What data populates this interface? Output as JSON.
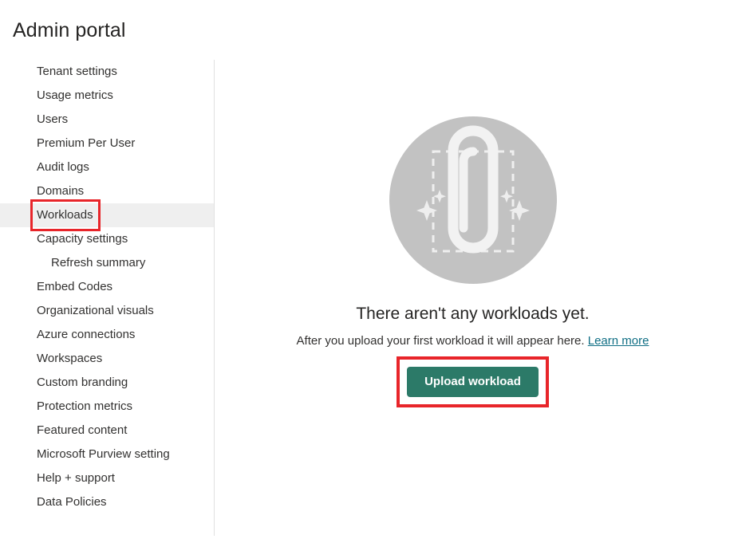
{
  "header": {
    "title": "Admin portal"
  },
  "colors": {
    "annotation_red": "#e8252a",
    "button_green": "#2c7a68",
    "link_teal": "#0f6e84",
    "selected_row": "#efefef",
    "illustration_circle": "#c2c2c2",
    "illustration_white": "#f1f1f1"
  },
  "sidebar": {
    "items": [
      {
        "label": "Tenant settings",
        "selected": false,
        "sub": false,
        "annotated": false
      },
      {
        "label": "Usage metrics",
        "selected": false,
        "sub": false,
        "annotated": false
      },
      {
        "label": "Users",
        "selected": false,
        "sub": false,
        "annotated": false
      },
      {
        "label": "Premium Per User",
        "selected": false,
        "sub": false,
        "annotated": false
      },
      {
        "label": "Audit logs",
        "selected": false,
        "sub": false,
        "annotated": false
      },
      {
        "label": "Domains",
        "selected": false,
        "sub": false,
        "annotated": false
      },
      {
        "label": "Workloads",
        "selected": true,
        "sub": false,
        "annotated": true
      },
      {
        "label": "Capacity settings",
        "selected": false,
        "sub": false,
        "annotated": false
      },
      {
        "label": "Refresh summary",
        "selected": false,
        "sub": true,
        "annotated": false
      },
      {
        "label": "Embed Codes",
        "selected": false,
        "sub": false,
        "annotated": false
      },
      {
        "label": "Organizational visuals",
        "selected": false,
        "sub": false,
        "annotated": false
      },
      {
        "label": "Azure connections",
        "selected": false,
        "sub": false,
        "annotated": false
      },
      {
        "label": "Workspaces",
        "selected": false,
        "sub": false,
        "annotated": false
      },
      {
        "label": "Custom branding",
        "selected": false,
        "sub": false,
        "annotated": false
      },
      {
        "label": "Protection metrics",
        "selected": false,
        "sub": false,
        "annotated": false
      },
      {
        "label": "Featured content",
        "selected": false,
        "sub": false,
        "annotated": false
      },
      {
        "label": "Microsoft Purview setting",
        "selected": false,
        "sub": false,
        "annotated": false
      },
      {
        "label": "Help + support",
        "selected": false,
        "sub": false,
        "annotated": false
      },
      {
        "label": "Data Policies",
        "selected": false,
        "sub": false,
        "annotated": false
      }
    ]
  },
  "main": {
    "illustration_icon": "paperclip-upload-icon",
    "empty_title": "There aren't any workloads yet.",
    "empty_subtitle": "After you upload your first workload it will appear here.",
    "learn_more_label": "Learn more",
    "upload_button_label": "Upload workload"
  }
}
